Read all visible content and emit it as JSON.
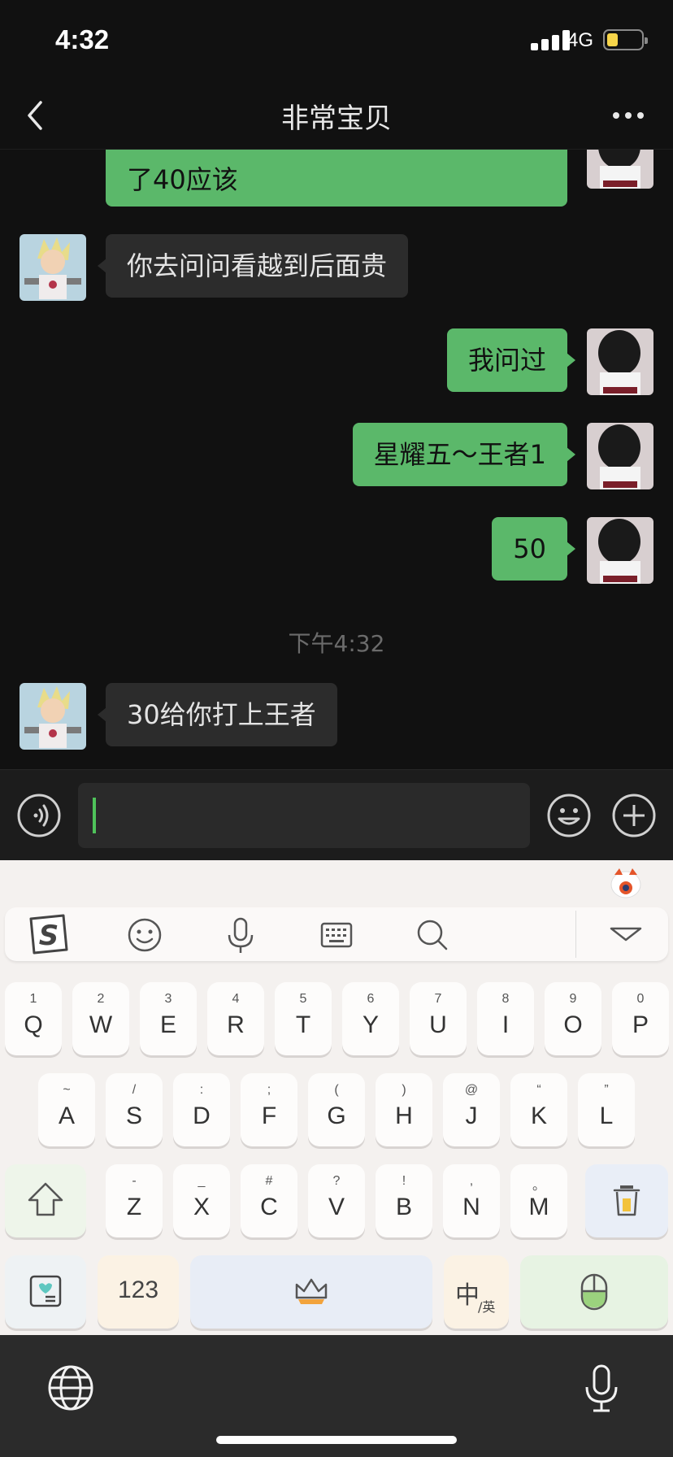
{
  "status_bar": {
    "time": "4:32",
    "network": "4G"
  },
  "nav": {
    "title": "非常宝贝"
  },
  "messages": [
    {
      "side": "me",
      "text": "了40应该"
    },
    {
      "side": "them",
      "text": "你去问问看越到后面贵"
    },
    {
      "side": "me",
      "text": "我问过"
    },
    {
      "side": "me",
      "text": "星耀五～王者1"
    },
    {
      "side": "me",
      "text": "50"
    },
    {
      "side": "them",
      "text": "30给你打上王者"
    }
  ],
  "timestamp": "下午4:32",
  "input": {
    "value": ""
  },
  "keyboard": {
    "toolbar_icons": [
      "sogou-logo-icon",
      "emoji-icon",
      "microphone-icon",
      "keyboard-icon",
      "search-icon",
      "collapse-icon"
    ],
    "row1": [
      {
        "num": "1",
        "letter": "Q"
      },
      {
        "num": "2",
        "letter": "W"
      },
      {
        "num": "3",
        "letter": "E"
      },
      {
        "num": "4",
        "letter": "R"
      },
      {
        "num": "5",
        "letter": "T"
      },
      {
        "num": "6",
        "letter": "Y"
      },
      {
        "num": "7",
        "letter": "U"
      },
      {
        "num": "8",
        "letter": "I"
      },
      {
        "num": "9",
        "letter": "O"
      },
      {
        "num": "0",
        "letter": "P"
      }
    ],
    "row2": [
      {
        "num": "~",
        "letter": "A"
      },
      {
        "num": "/",
        "letter": "S"
      },
      {
        "num": ":",
        "letter": "D"
      },
      {
        "num": ";",
        "letter": "F"
      },
      {
        "num": "(",
        "letter": "G"
      },
      {
        "num": ")",
        "letter": "H"
      },
      {
        "num": "@",
        "letter": "J"
      },
      {
        "num": "“",
        "letter": "K"
      },
      {
        "num": "”",
        "letter": "L"
      }
    ],
    "row3": [
      {
        "num": "-",
        "letter": "Z"
      },
      {
        "num": "_",
        "letter": "X"
      },
      {
        "num": "#",
        "letter": "C"
      },
      {
        "num": "?",
        "letter": "V"
      },
      {
        "num": "!",
        "letter": "B"
      },
      {
        "num": ",",
        "letter": "N"
      },
      {
        "num": "。",
        "letter": "M"
      }
    ],
    "numbers_label": "123",
    "lang_main": "中",
    "lang_sub": "/英"
  }
}
